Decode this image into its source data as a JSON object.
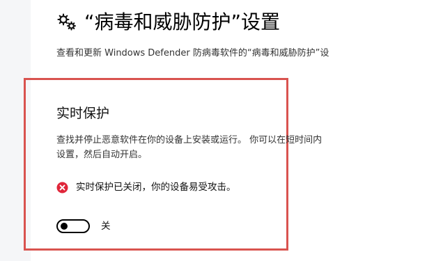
{
  "header": {
    "title": "“病毒和威胁防护”设置",
    "subtitle": "查看和更新 Windows Defender 防病毒软件的“病毒和威胁防护”设"
  },
  "realtime": {
    "title": "实时保护",
    "description_lines": [
      "查找并停止恶意软件在你的设备上安装或运行。 你可以在短时间内",
      "设置，然后自动开启。"
    ],
    "warning": "实时保护已关闭，你的设备易受攻击。",
    "toggle_state": "off",
    "toggle_label": "关"
  },
  "colors": {
    "highlight": "#d9534f",
    "error": "#e0263a"
  },
  "icons": {
    "title_icon": "gear-icon",
    "warning_icon": "error-icon"
  }
}
